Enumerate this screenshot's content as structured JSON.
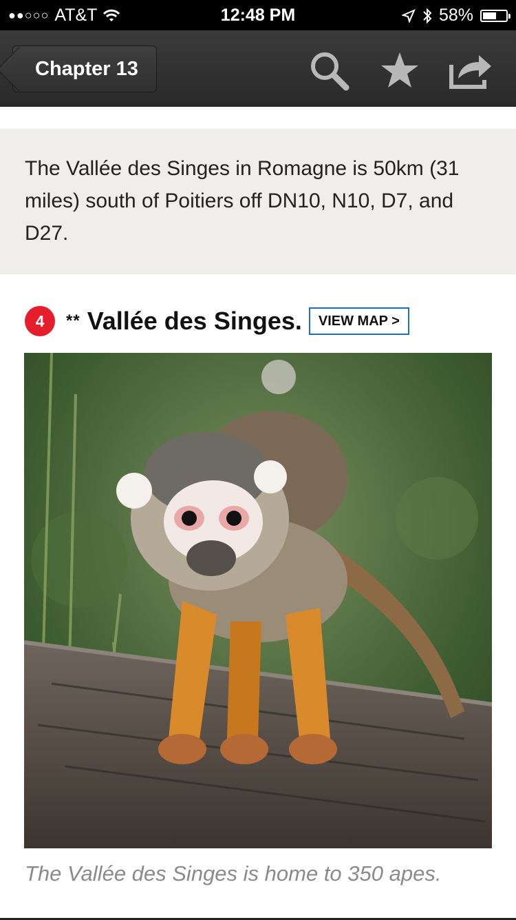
{
  "status_bar": {
    "signal": "●●○○○",
    "carrier": "AT&T",
    "time": "12:48 PM",
    "battery": "58%",
    "battery_level": 0.58
  },
  "nav": {
    "back_label": "Chapter 13",
    "icons": [
      "search-icon",
      "star-icon",
      "share-icon"
    ]
  },
  "info": {
    "text": "The Vallée des Singes in Romagne is 50km (31 miles) south of Poitiers off DN10, N10, D7, and D27."
  },
  "entry": {
    "number": "4",
    "stars": "**",
    "title": "Vallée des Singes.",
    "map_button": "VIEW MAP >"
  },
  "photo": {
    "caption": "The Vallée des Singes is home to 350 apes."
  },
  "colors": {
    "nav_background": "#2f2f2f",
    "info_background": "#efeeeb",
    "badge": "#e41e2b",
    "map_button_border": "#1a73b8"
  }
}
